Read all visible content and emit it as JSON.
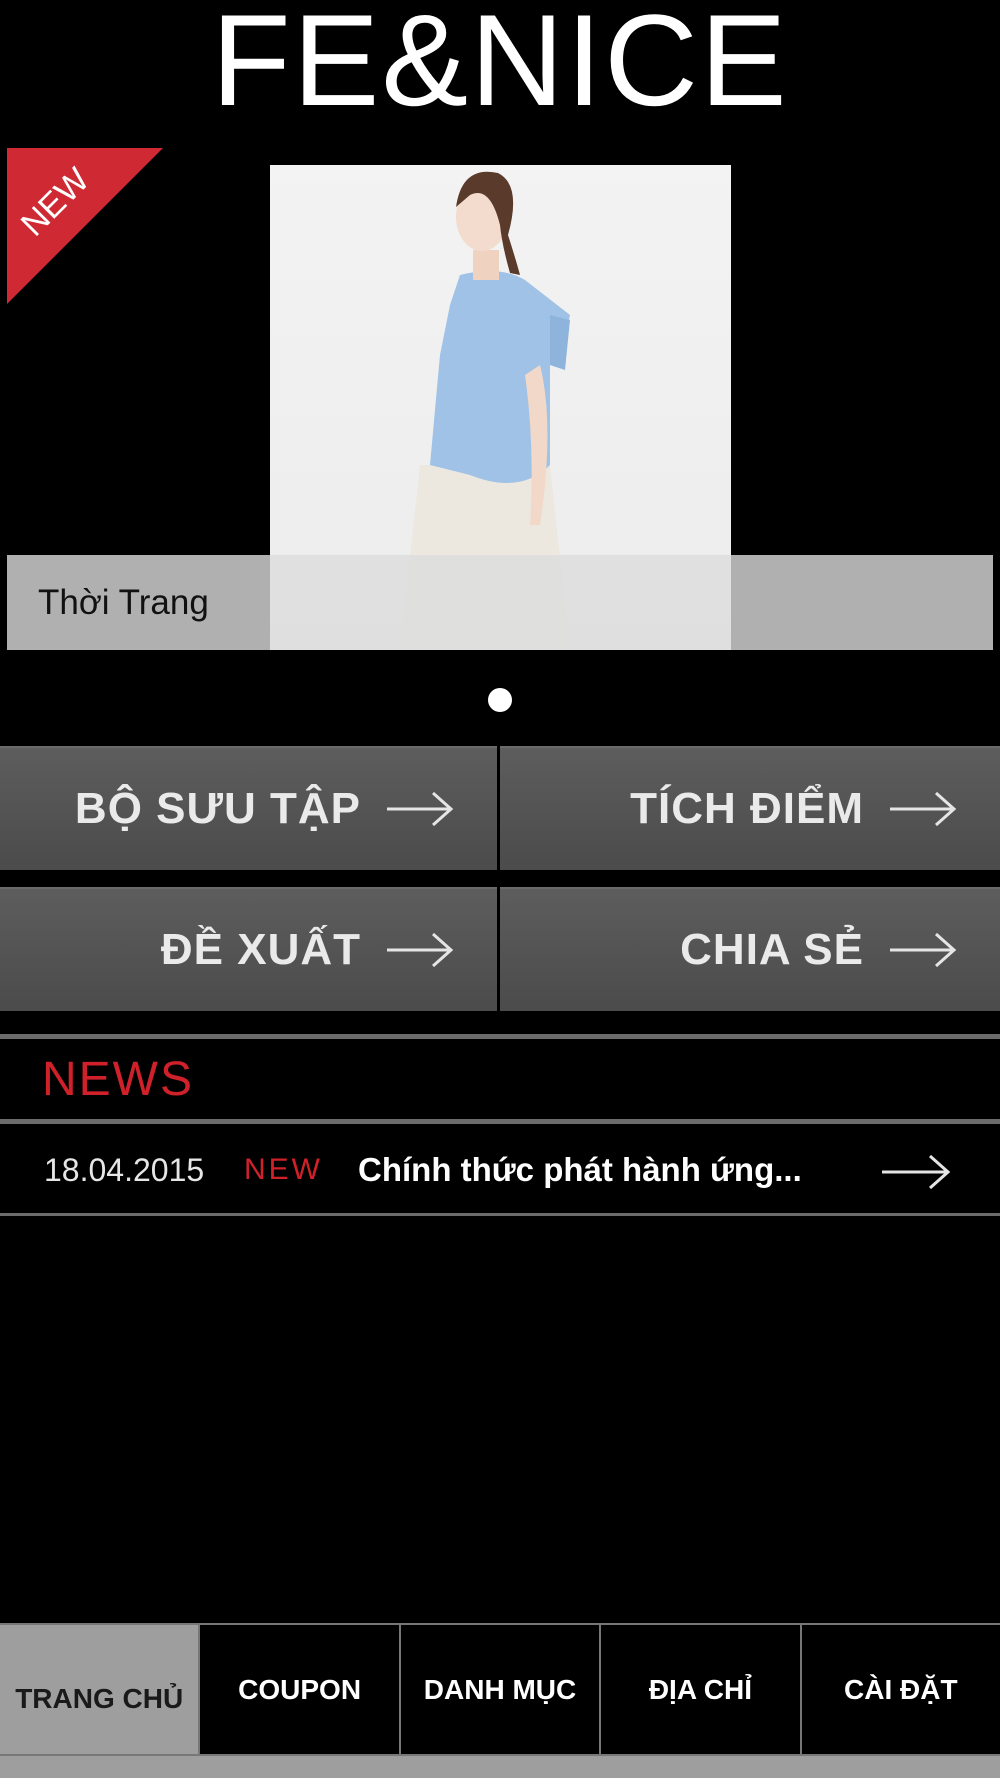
{
  "app": {
    "logo": "FE&NICE"
  },
  "banner": {
    "ribbon_text": "NEW",
    "caption": "Thời Trang",
    "colors": {
      "ribbon": "#cf2a33"
    }
  },
  "menu_tiles": [
    {
      "label": "BỘ SƯU TẬP"
    },
    {
      "label": "TÍCH ĐIỂM"
    },
    {
      "label": "ĐỀ XUẤT"
    },
    {
      "label": "CHIA SẺ"
    }
  ],
  "news": {
    "title": "NEWS",
    "items": [
      {
        "date": "18.04.2015",
        "badge": "NEW",
        "headline": "Chính thức phát hành ứng..."
      }
    ]
  },
  "tabbar": {
    "tabs": [
      {
        "label": "TRANG CHỦ",
        "active": true
      },
      {
        "label": "COUPON"
      },
      {
        "label": "DANH MỤC"
      },
      {
        "label": "ĐỊA CHỈ"
      },
      {
        "label": "CÀI ĐẶT"
      }
    ]
  }
}
